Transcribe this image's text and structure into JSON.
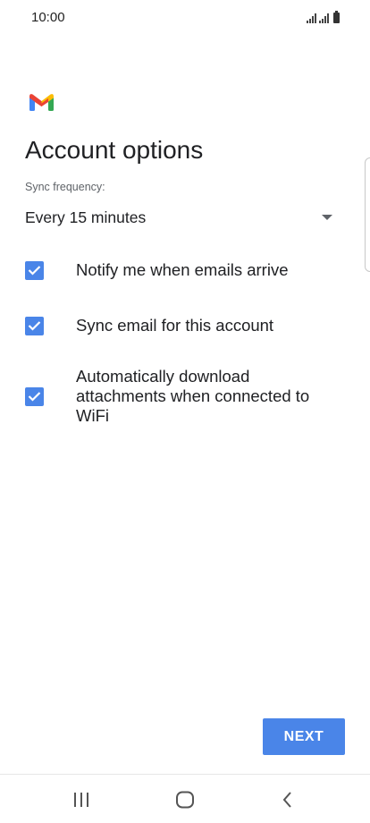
{
  "status_bar": {
    "time": "10:00"
  },
  "app": {
    "logo_icon": "gmail-logo-icon"
  },
  "page": {
    "title": "Account options"
  },
  "sync": {
    "label": "Sync frequency:",
    "value": "Every 15 minutes"
  },
  "options": [
    {
      "label": "Notify me when emails arrive",
      "checked": true
    },
    {
      "label": "Sync email for this account",
      "checked": true
    },
    {
      "label": "Automatically download attachments when connected to WiFi",
      "checked": true
    }
  ],
  "actions": {
    "next_label": "NEXT"
  },
  "colors": {
    "accent": "#4a85e8",
    "text_primary": "#202124",
    "text_secondary": "#5f6368"
  },
  "nav": {
    "recents_icon": "recents-icon",
    "home_icon": "home-icon",
    "back_icon": "back-icon"
  }
}
